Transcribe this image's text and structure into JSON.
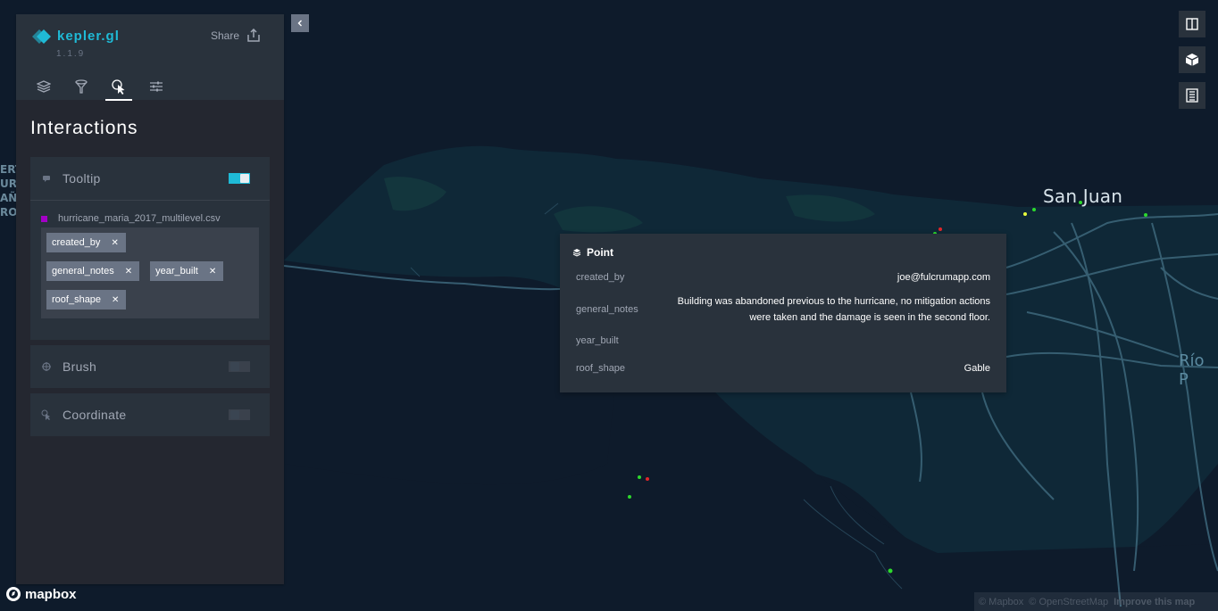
{
  "app": {
    "title": "kepler.gl",
    "version": "1.1.9",
    "share_label": "Share"
  },
  "tabs": [
    "layer-icon",
    "filter-icon",
    "interaction-icon",
    "map-settings-icon"
  ],
  "interactions": {
    "title": "Interactions",
    "tooltip": {
      "label": "Tooltip",
      "enabled": true,
      "dataset": "hurricane_maria_2017_multilevel.csv",
      "dataset_color": "#a400c7",
      "fields": [
        "created_by",
        "general_notes",
        "year_built",
        "roof_shape"
      ]
    },
    "brush": {
      "label": "Brush",
      "enabled": false
    },
    "coordinate": {
      "label": "Coordinate",
      "enabled": false
    }
  },
  "map": {
    "labels": {
      "city": "San Juan",
      "town": "Río P",
      "edge": [
        "ERT",
        "UR",
        "AÑ",
        "RO"
      ]
    },
    "colors": {
      "water": "#0e1b2b",
      "land": "#0f2a3a",
      "roads": "#3b6478"
    }
  },
  "popup": {
    "title": "Point",
    "rows": [
      {
        "key": "created_by",
        "value": "joe@fulcrumapp.com"
      },
      {
        "key": "general_notes",
        "value": "Building was abandoned previous to the hurricane, no mitigation actions were taken and the damage is seen in the second floor."
      },
      {
        "key": "year_built",
        "value": ""
      },
      {
        "key": "roof_shape",
        "value": "Gable"
      }
    ]
  },
  "footer": {
    "mapbox_logo": "mapbox",
    "attribution": [
      "© Mapbox",
      "© OpenStreetMap",
      "Improve this map"
    ]
  },
  "accent": "#1fbad6"
}
